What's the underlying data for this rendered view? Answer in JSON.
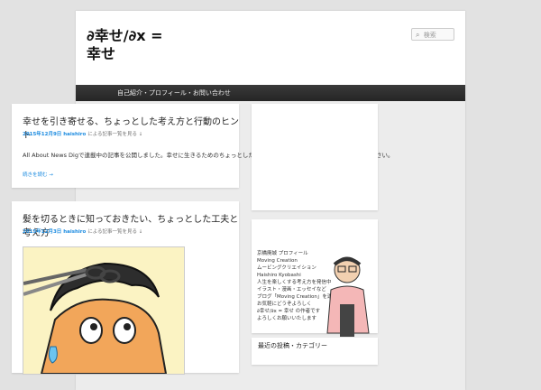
{
  "header": {
    "title_line1": "∂幸せ/∂x =",
    "title_line2": "幸せ",
    "search_placeholder": "検索"
  },
  "nav": {
    "items": [
      {
        "label": "自己紹介・プロフィール・お問い合わせ"
      }
    ]
  },
  "posts": [
    {
      "title": "幸せを引き寄せる、ちょっとした考え方と行動のヒント",
      "date": "2015年12月9日",
      "author": "haishiro",
      "by_text": "による記事一覧を見る ↓",
      "excerpt": "All About News Digで連載中の記事を公開しました。幸せに生きるためのちょっとしたヒントを紹介しています。ぜひ読んでみてください。",
      "readmore": "続きを読む →"
    },
    {
      "title": "髪を切るときに知っておきたい、ちょっとした工夫と考え方",
      "date": "2015年12月3日",
      "author": "haishiro",
      "by_text": "による記事一覧を見る ↓"
    }
  ],
  "sidebar": {
    "profile": {
      "lines": [
        "京橋廃城 プロフィール",
        "Moving Creation",
        "ムービングクリエイション",
        "Haishiro Kyobashi",
        "",
        "人生を楽しくする考え方を発信中",
        "イラスト・漫画・エッセイなど",
        "ブログ「Moving Creation」を運営しています",
        "お気軽にどうぞよろしく",
        "∂幸せ/∂x = 幸せ の作者です",
        "よろしくお願いいたします"
      ]
    },
    "widget_title": "最近の投稿・カテゴリー"
  }
}
